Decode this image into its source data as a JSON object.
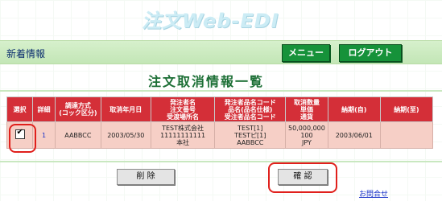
{
  "app_title": "注文Web-EDI",
  "header": {
    "title": "新着情報",
    "menu_label": "メニュー",
    "logout_label": "ログアウト"
  },
  "page_title": "注文取消情報一覧",
  "table": {
    "headers": {
      "select": "選択",
      "detail": "詳細",
      "procurement": "調達方式\n(コック区分)",
      "cancel_date": "取消年月日",
      "orderer": "発注者名\n注文番号\n受渡場所名",
      "product": "発注者品名コード\n品名(品名仕様)\n受注者品名コード",
      "quantity": "取消数量\n単価\n通貨",
      "delivery_from": "納期(自)",
      "delivery_to": "納期(至)"
    },
    "rows": [
      {
        "checked": "✔",
        "detail": "1",
        "procurement": "AABBCC",
        "cancel_date": "2003/05/30",
        "orderer": "TEST株式会社\n11111111111\n本社",
        "product": "TEST[1]\nTESTピ[1]\nAABBCC",
        "quantity": "50,000,000\n100\nJPY",
        "delivery_from": "2003/06/01",
        "delivery_to": ""
      }
    ]
  },
  "buttons": {
    "delete": "削 除",
    "confirm": "確 認"
  },
  "inquiry_link": "お問合せ",
  "colors": {
    "header_red": "#d42f38",
    "row_pink": "#f6cfc6",
    "button_green": "#16923a",
    "title_green": "#1c6f35",
    "highlight_red": "#e0201c"
  }
}
